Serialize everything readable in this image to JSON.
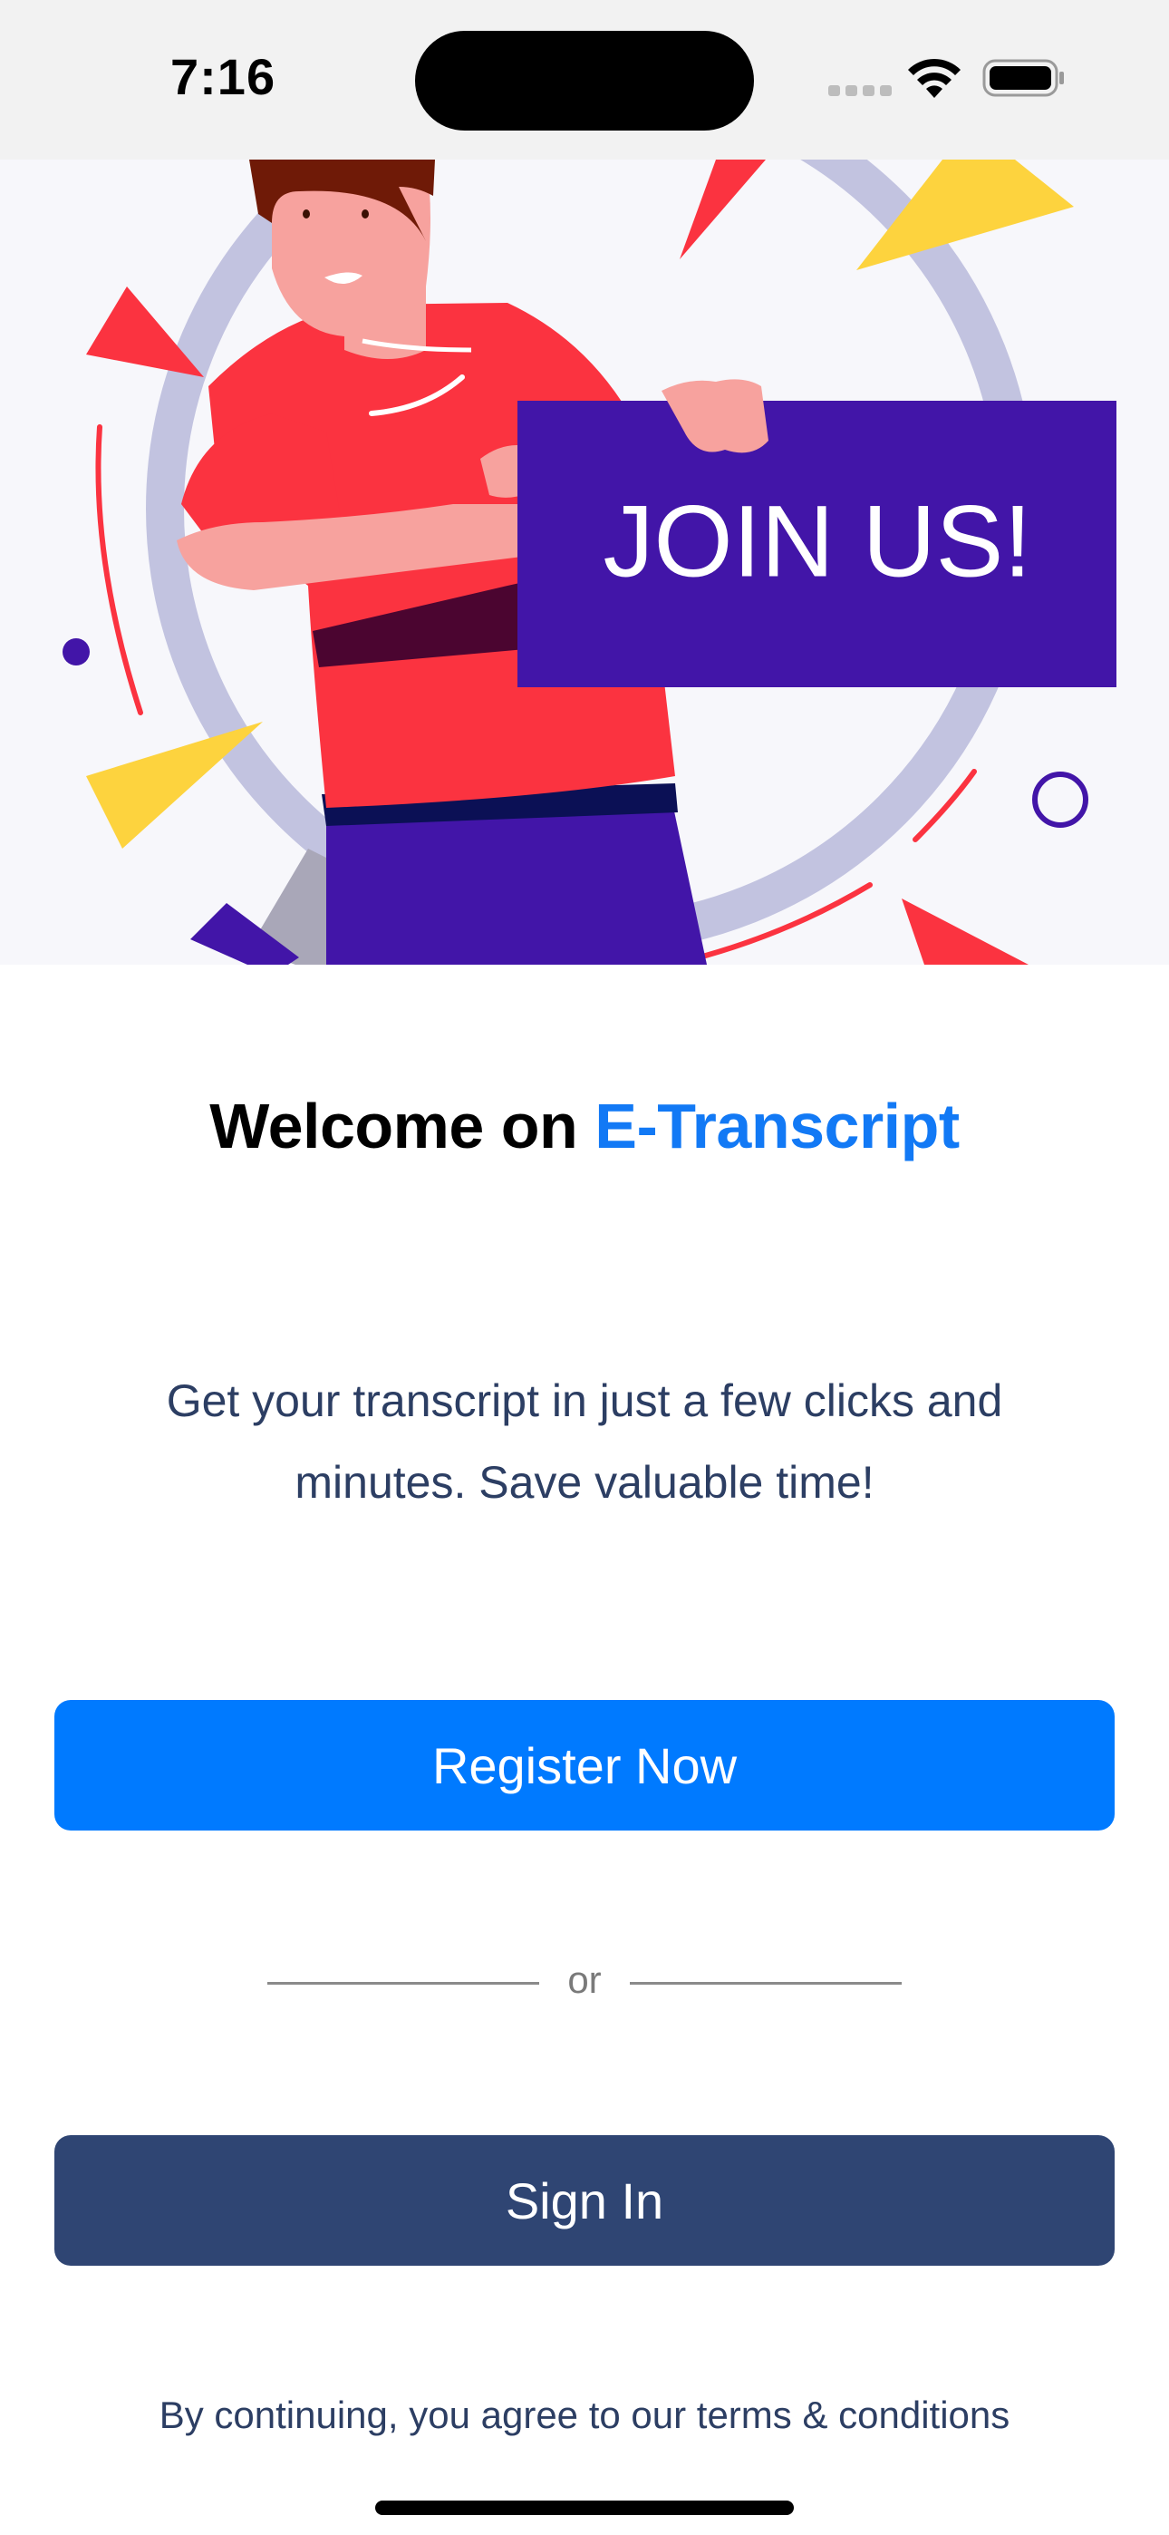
{
  "status_bar": {
    "time": "7:16"
  },
  "hero": {
    "sign_text": "JOIN US!",
    "colors": {
      "sign": "#4215a8",
      "shirt": "#fb3340",
      "ring": "#c2c3e0",
      "yellow": "#fdd33e"
    }
  },
  "welcome": {
    "prefix": "Welcome on ",
    "brand": "E-Transcript"
  },
  "description": "Get your transcript in just a few clicks and minutes. Save valuable time!",
  "buttons": {
    "register_label": "Register Now",
    "signin_label": "Sign In"
  },
  "divider": {
    "text": "or"
  },
  "terms": "By continuing, you agree to our terms & conditions",
  "colors": {
    "primary": "#007aff",
    "secondary": "#2f4573",
    "brand_text": "#1279f5",
    "body_text": "#2c3e63"
  }
}
